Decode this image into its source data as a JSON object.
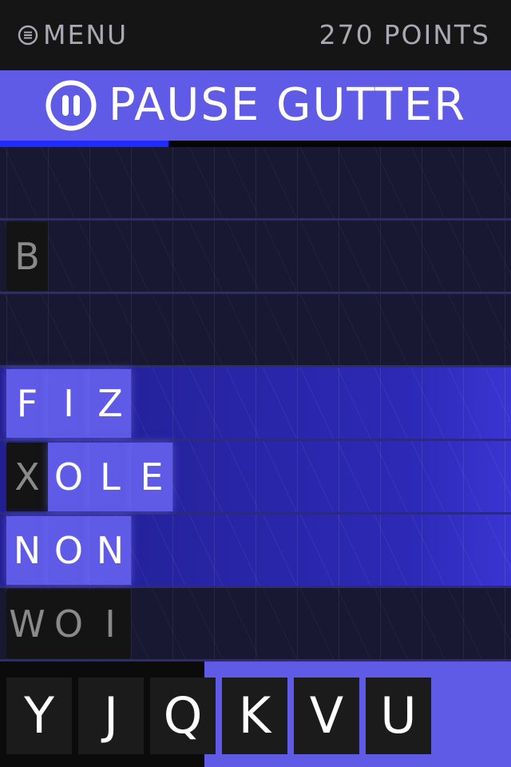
{
  "header": {
    "menu_label": "MENU",
    "menu_icon": "list-circle-icon",
    "points_value": "270",
    "points_label": "POINTS"
  },
  "pause": {
    "label": "PAUSE GUTTER",
    "icon": "pause-circle-icon"
  },
  "progress": {
    "fraction": 0.33
  },
  "board": {
    "rows": [
      {
        "active": false,
        "tiles": []
      },
      {
        "active": false,
        "tiles": [
          {
            "letter": "B",
            "state": "dead"
          }
        ]
      },
      {
        "active": false,
        "tiles": []
      },
      {
        "active": true,
        "tiles": [
          {
            "letter": "F",
            "state": "placed"
          },
          {
            "letter": "I",
            "state": "placed"
          },
          {
            "letter": "Z",
            "state": "placed"
          }
        ]
      },
      {
        "active": true,
        "tiles": [
          {
            "letter": "X",
            "state": "dead"
          },
          {
            "letter": "O",
            "state": "placed"
          },
          {
            "letter": "L",
            "state": "placed"
          },
          {
            "letter": "E",
            "state": "placed"
          }
        ]
      },
      {
        "active": true,
        "tiles": [
          {
            "letter": "N",
            "state": "placed"
          },
          {
            "letter": "O",
            "state": "placed"
          },
          {
            "letter": "N",
            "state": "placed"
          }
        ]
      },
      {
        "active": false,
        "tiles": [
          {
            "letter": "W",
            "state": "dead"
          },
          {
            "letter": "O",
            "state": "dead"
          },
          {
            "letter": "I",
            "state": "dead"
          }
        ]
      }
    ]
  },
  "rack": {
    "letters": [
      "Y",
      "J",
      "Q",
      "K",
      "V",
      "U"
    ]
  },
  "colors": {
    "accent": "#5f5be6",
    "progress": "#1e2cff",
    "dead_tile": "#141414",
    "text_muted": "#a9a9b3"
  }
}
